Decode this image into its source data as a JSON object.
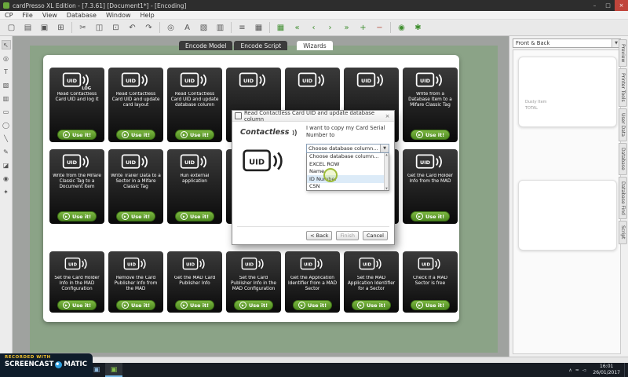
{
  "window": {
    "title": "cardPresso XL Edition - [7.3.61] [Document1*] - [Encoding]",
    "minimize": "–",
    "maximize": "□",
    "close": "×"
  },
  "menubar": {
    "items": [
      "CP",
      "File",
      "View",
      "Database",
      "Window",
      "Help"
    ]
  },
  "toolbar": {
    "buttons": [
      {
        "name": "new-document-icon",
        "glyph": "▢"
      },
      {
        "name": "open-document-icon",
        "glyph": "▤"
      },
      {
        "name": "save-document-icon",
        "glyph": "▣"
      },
      {
        "name": "print-icon",
        "glyph": "⊞"
      },
      {
        "sep": true
      },
      {
        "name": "cut-icon",
        "glyph": "✂"
      },
      {
        "name": "copy-icon",
        "glyph": "◫"
      },
      {
        "name": "paste-icon",
        "glyph": "⊡"
      },
      {
        "name": "undo-icon",
        "glyph": "↶"
      },
      {
        "name": "redo-icon",
        "glyph": "↷"
      },
      {
        "sep": true
      },
      {
        "name": "zoom-icon",
        "glyph": "◎"
      },
      {
        "name": "text-item-icon",
        "glyph": "A"
      },
      {
        "name": "image-item-icon",
        "glyph": "▧"
      },
      {
        "name": "barcode-item-icon",
        "glyph": "▥"
      },
      {
        "sep": true
      },
      {
        "name": "align-icon",
        "glyph": "≡"
      },
      {
        "name": "grid-icon",
        "glyph": "▦"
      },
      {
        "sep": true
      },
      {
        "name": "database-table-icon",
        "glyph": "▦",
        "color": "#3e8e2e"
      },
      {
        "name": "database-first-record-icon",
        "glyph": "«",
        "color": "#3e8e2e"
      },
      {
        "name": "database-previous-record-icon",
        "glyph": "‹",
        "color": "#3e8e2e"
      },
      {
        "name": "database-next-record-icon",
        "glyph": "›",
        "color": "#3e8e2e"
      },
      {
        "name": "database-last-record-icon",
        "glyph": "»",
        "color": "#3e8e2e"
      },
      {
        "name": "database-add-record-icon",
        "glyph": "+",
        "color": "#3e8e2e"
      },
      {
        "name": "database-remove-record-icon",
        "glyph": "−",
        "color": "#b44a3a"
      },
      {
        "sep": true
      },
      {
        "name": "encode-icon",
        "glyph": "◉",
        "color": "#3e8e2e"
      },
      {
        "name": "wizard-icon",
        "glyph": "✱",
        "color": "#3e8e2e"
      }
    ]
  },
  "left_toolbar": {
    "tools": [
      {
        "name": "pointer-tool-icon",
        "glyph": "↖",
        "active": true
      },
      {
        "name": "zoom-tool-icon",
        "glyph": "◎"
      },
      {
        "name": "text-tool-icon",
        "glyph": "T"
      },
      {
        "name": "image-tool-icon",
        "glyph": "▧"
      },
      {
        "name": "barcode-tool-icon",
        "glyph": "▥"
      },
      {
        "name": "rectangle-tool-icon",
        "glyph": "▭"
      },
      {
        "name": "ellipse-tool-icon",
        "glyph": "◯"
      },
      {
        "name": "line-tool-icon",
        "glyph": "╲"
      },
      {
        "name": "pen-tool-icon",
        "glyph": "✎"
      },
      {
        "name": "eraser-tool-icon",
        "glyph": "◪"
      },
      {
        "name": "encode-tool-icon",
        "glyph": "◉"
      },
      {
        "name": "settings-tool-icon",
        "glyph": "✦"
      }
    ]
  },
  "workspace": {
    "tabs": [
      {
        "label": "Encode Model",
        "active": false
      },
      {
        "label": "Encode Script",
        "active": false
      },
      {
        "label": "Wizards",
        "active": true
      }
    ]
  },
  "wizards": {
    "use_label": "Use it!",
    "play_glyph": "▶",
    "tiles": [
      {
        "label": "Read Contactless Card UID and log it",
        "badge": "LOG"
      },
      {
        "label": "Read Contactless Card UID and update card layout"
      },
      {
        "label": "Read Contactless Card UID and update database column"
      },
      {
        "label": ""
      },
      {
        "label": ""
      },
      {
        "label": ""
      },
      {
        "label": "Write from a Database Item to a Mifare Classic Tag"
      },
      {
        "label": "Write from the Mifare Classic Tag to a Document Item"
      },
      {
        "label": "Write Trailer Data to a Sector in a Mifare Classic Tag"
      },
      {
        "label": "Run external application"
      },
      {
        "label": ""
      },
      {
        "label": ""
      },
      {
        "label": ""
      },
      {
        "label": "Get the Card Holder Info from the MAD"
      },
      {
        "label": "Set the Card Holder Info in the MAD Configuration"
      },
      {
        "label": "Remove the Card Publisher Info from the MAD"
      },
      {
        "label": "Get the MAD Card Publisher Info"
      },
      {
        "label": "Set the Card Publisher Info in the MAD Configuration"
      },
      {
        "label": "Get the Application Identifier from a MAD Sector"
      },
      {
        "label": "Set the MAD Application Identifier for a Sector"
      },
      {
        "label": "Check if a MAD Sector is free"
      }
    ]
  },
  "dialog": {
    "title": "Read Contactless Card UID and update database column",
    "close": "×",
    "contactless_label": "Contactless",
    "prompt": "I want to copy my Card Serial Number to",
    "dropdown": {
      "value": "Choose database column...",
      "arrow": "▼",
      "options": [
        "Choose database column...",
        "EXCEL ROW",
        "Name",
        "ID Number",
        "CSN"
      ],
      "highlighted": "ID Number"
    },
    "buttons": {
      "back": "< Back",
      "finish": "Finish",
      "cancel": "Cancel"
    }
  },
  "right_panel": {
    "header": "Front & Back",
    "arrow": "▼",
    "preview_note_line1": "Dusty Item",
    "preview_note_line2": "TOTAL",
    "side_tabs": [
      "Preview",
      "Printer Tools",
      "User Data",
      "Database",
      "Database Find",
      "Script"
    ]
  },
  "taskbar": {
    "start_glyph": "⊞",
    "icons": [
      {
        "name": "taskbar-search-icon",
        "glyph": "○",
        "color": "#cfd6de"
      },
      {
        "name": "taskbar-explorer-icon",
        "glyph": "▤",
        "color": "#f3c84f"
      },
      {
        "name": "taskbar-browser-icon",
        "glyph": "e",
        "color": "#57b8ea"
      },
      {
        "name": "taskbar-app1-icon",
        "glyph": "▣",
        "color": "#e07a4e"
      },
      {
        "name": "taskbar-app2-icon",
        "glyph": "▣",
        "color": "#8ab4d8"
      },
      {
        "name": "taskbar-cardpresso-icon",
        "glyph": "▣",
        "color": "#86c04a",
        "active": true
      }
    ],
    "tray": [
      {
        "name": "tray-hidden-icons-icon",
        "glyph": "∧"
      },
      {
        "name": "tray-network-icon",
        "glyph": "≈"
      },
      {
        "name": "tray-volume-icon",
        "glyph": "◅"
      }
    ],
    "time": "16:01",
    "date": "26/01/2017"
  },
  "watermark": {
    "prefix": "RECORDED WITH",
    "brand_left": "SCREENCAST",
    "brand_right": "MATIC"
  },
  "colors": {
    "accent_green": "#5c9c30",
    "board_green": "#8ba387",
    "tile_dark": "#101010"
  }
}
